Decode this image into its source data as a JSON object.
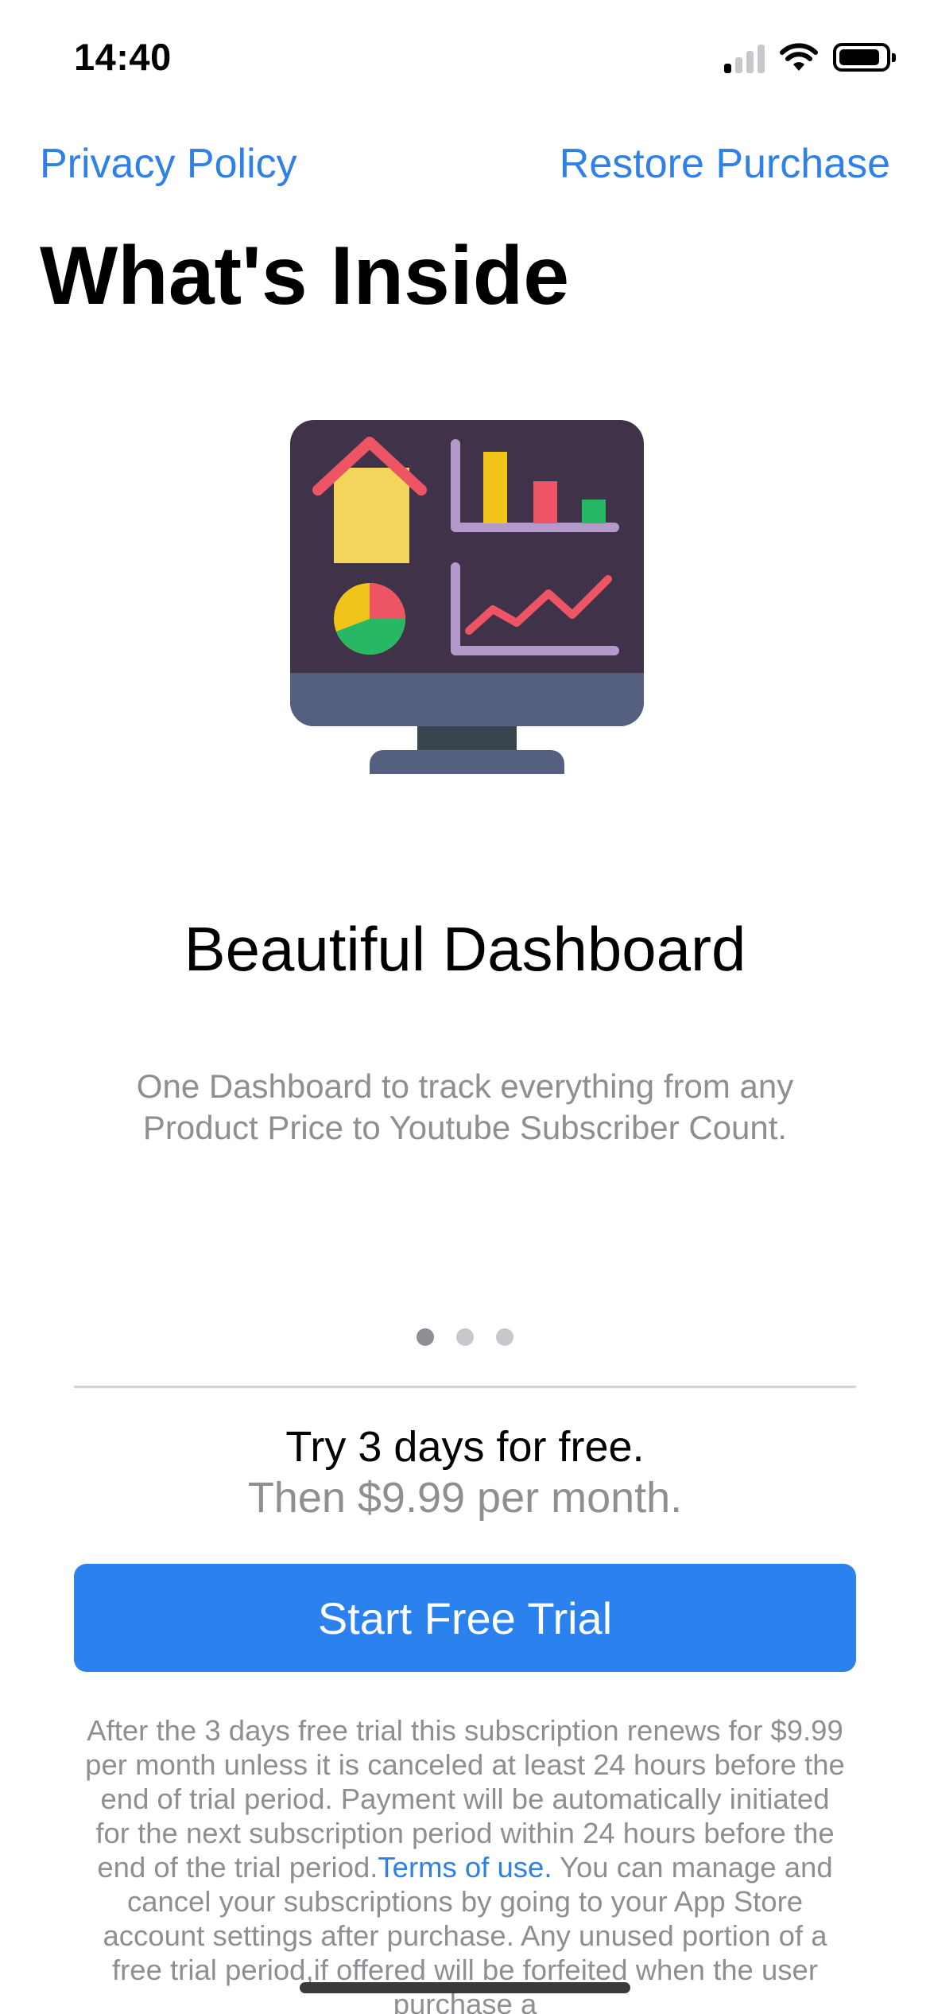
{
  "status_bar": {
    "time": "14:40",
    "icons": [
      "cellular-signal-icon",
      "wifi-icon",
      "battery-icon"
    ]
  },
  "header": {
    "privacy_label": "Privacy Policy",
    "restore_label": "Restore Purchase",
    "title": "What's Inside"
  },
  "feature": {
    "illustration_icon": "dashboard-monitor-icon",
    "title": "Beautiful Dashboard",
    "description": "One Dashboard to track everything from any Product Price to Youtube Subscriber Count."
  },
  "pager": {
    "count": 3,
    "active_index": 0
  },
  "pricing": {
    "line1": "Try 3 days for free.",
    "line2": "Then $9.99 per month."
  },
  "cta": {
    "label": "Start Free Trial"
  },
  "legal": {
    "part1": "After the 3 days free trial this subscription renews for $9.99 per month unless it is canceled at least 24 hours before the end of trial period. Payment will be automatically initiated for the next subscription period within 24 hours before the end of the trial period.",
    "terms_label": "Terms of use.",
    "part2": " You can manage and cancel your subscriptions by going to your App Store account settings after purchase. Any unused portion of a free trial period,if offered will be forfeited when the user purchase a"
  },
  "colors": {
    "accent": "#2b82ee",
    "link": "#2f80e8",
    "secondary_text": "#8e8e93"
  }
}
